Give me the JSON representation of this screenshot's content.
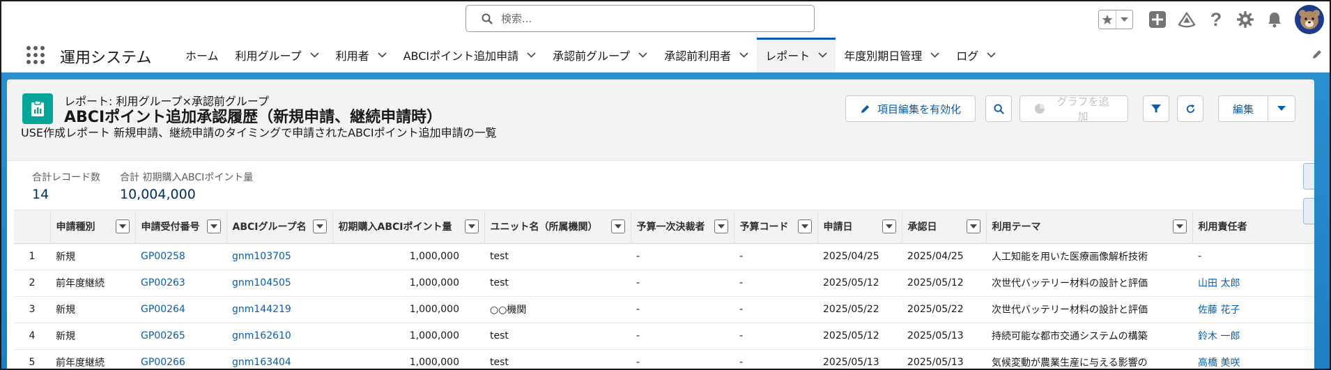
{
  "search": {
    "placeholder": "検索..."
  },
  "header": {
    "icons": [
      "star-icon",
      "chevron-down-icon",
      "plus-icon",
      "trailhead-icon",
      "help-icon",
      "gear-icon",
      "bell-icon",
      "avatar"
    ]
  },
  "app": {
    "name": "運用システム",
    "nav": [
      {
        "label": "ホーム",
        "has_menu": false
      },
      {
        "label": "利用グループ",
        "has_menu": true
      },
      {
        "label": "利用者",
        "has_menu": true
      },
      {
        "label": "ABCIポイント追加申請",
        "has_menu": true
      },
      {
        "label": "承認前グループ",
        "has_menu": true
      },
      {
        "label": "承認前利用者",
        "has_menu": true
      },
      {
        "label": "レポート",
        "has_menu": true,
        "active": true
      },
      {
        "label": "年度別期日管理",
        "has_menu": true
      },
      {
        "label": "ログ",
        "has_menu": true
      }
    ]
  },
  "report": {
    "type_label": "レポート: 利用グループ×承認前グループ",
    "title": "ABCIポイント追加承認履歴（新規申請、継続申請時）",
    "description": "USE作成レポート 新規申請、継続申請のタイミングで申請されたABCIポイント追加申請の一覧",
    "actions": {
      "enable_field_edit": "項目編集を有効化",
      "add_chart": "グラフを追加",
      "edit": "編集"
    }
  },
  "summary": [
    {
      "label": "合計レコード数",
      "value": "14"
    },
    {
      "label": "合計 初期購入ABCIポイント量",
      "value": "10,004,000"
    }
  ],
  "table": {
    "columns": [
      "申請種別",
      "申請受付番号",
      "ABCIグループ名",
      "初期購入ABCIポイント量",
      "ユニット名（所属機関）",
      "予算一次決裁者",
      "予算コード",
      "申請日",
      "承認日",
      "利用テーマ",
      "利用責任者"
    ],
    "rows": [
      {
        "n": "1",
        "type": "新規",
        "no": "GP00258",
        "group": "gnm103705",
        "points": "1,000,000",
        "unit": "test",
        "approver": "-",
        "budget": "-",
        "applied": "2025/04/25",
        "approved": "2025/04/25",
        "theme": "人工知能を用いた医療画像解析技術",
        "owner": "-"
      },
      {
        "n": "2",
        "type": "前年度継続",
        "no": "GP00263",
        "group": "gnm104505",
        "points": "1,000,000",
        "unit": "test",
        "approver": "-",
        "budget": "-",
        "applied": "2025/05/12",
        "approved": "2025/05/12",
        "theme": "次世代バッテリー材料の設計と評価",
        "owner": "山田 太郎"
      },
      {
        "n": "3",
        "type": "新規",
        "no": "GP00264",
        "group": "gnm144219",
        "points": "1,000,000",
        "unit": "○○機関",
        "approver": "-",
        "budget": "-",
        "applied": "2025/05/22",
        "approved": "2025/05/22",
        "theme": "次世代バッテリー材料の設計と評価",
        "owner": "佐藤 花子"
      },
      {
        "n": "4",
        "type": "新規",
        "no": "GP00265",
        "group": "gnm162610",
        "points": "1,000,000",
        "unit": "test",
        "approver": "-",
        "budget": "-",
        "applied": "2025/05/12",
        "approved": "2025/05/13",
        "theme": "持続可能な都市交通システムの構築",
        "owner": "鈴木 一郎"
      },
      {
        "n": "5",
        "type": "前年度継続",
        "no": "GP00266",
        "group": "gnm163404",
        "points": "1,000,000",
        "unit": "test",
        "approver": "-",
        "budget": "-",
        "applied": "2025/05/13",
        "approved": "2025/05/13",
        "theme": "気候変動が農業生産に与える影響の",
        "owner": "高橋 美咲"
      }
    ]
  },
  "colors": {
    "brand_blue": "#0b5cab",
    "report_icon": "#06a59a",
    "band": "#1f7fc0"
  }
}
